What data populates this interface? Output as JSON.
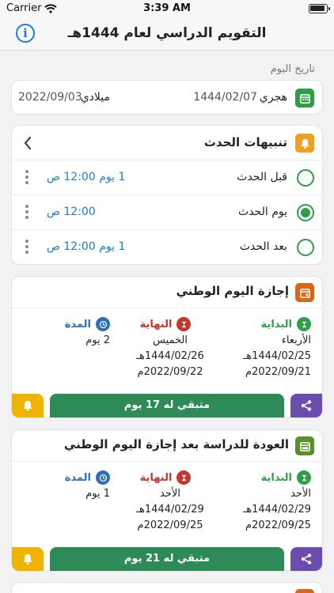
{
  "status_bar": {
    "carrier": "Carrier",
    "time": "3:39 AM"
  },
  "nav": {
    "title": "التقويم الدراسي لعام 1444هـ",
    "info_glyph": "i"
  },
  "today": {
    "caption": "تاريخ اليوم",
    "hijri_label": "هجري",
    "hijri_value": "1444/02/07",
    "greg_label": "ميلادي",
    "greg_value": "2022/09/03"
  },
  "alerts": {
    "title": "تنبيهات الحدث",
    "rows": [
      {
        "label": "قبل الحدث",
        "time": "1 يوم 12:00 ص",
        "selected": false
      },
      {
        "label": "يوم الحدث",
        "time": "12:00 ص",
        "selected": true
      },
      {
        "label": "بعد الحدث",
        "time": "1 يوم 12:00 ص",
        "selected": false
      }
    ]
  },
  "labels": {
    "start": "البداية",
    "end": "النهاية",
    "duration": "المدة"
  },
  "events": [
    {
      "title": "إجازة اليوم الوطني",
      "icon_color": "#d9661a",
      "start": {
        "day": "الأربعاء",
        "hijri": "1444/02/25هـ",
        "greg": "2022/09/21م"
      },
      "end": {
        "day": "الخميس",
        "hijri": "1444/02/26هـ",
        "greg": "2022/09/22م"
      },
      "duration": "2 يوم",
      "remaining": "متبقي له 17 يوم"
    },
    {
      "title": "العودة للدراسة بعد إجازة اليوم الوطني",
      "icon_color": "#5a8f2e",
      "start": {
        "day": "الأحد",
        "hijri": "1444/02/29هـ",
        "greg": "2022/09/25م"
      },
      "end": {
        "day": "الأحد",
        "hijri": "1444/02/29هـ",
        "greg": "2022/09/25م"
      },
      "duration": "1 يوم",
      "remaining": "متبقي له 21 يوم"
    }
  ],
  "colors": {
    "accent_blue": "#1e7cd6",
    "green": "#2e8b57",
    "calendar_green": "#2e9e47",
    "alert_orange": "#f0a020",
    "start_green": "#2e9e47",
    "end_red": "#c0392b",
    "duration_blue": "#2f6fb5",
    "bell_yellow": "#f0b400",
    "share_purple": "#6b4db0"
  }
}
